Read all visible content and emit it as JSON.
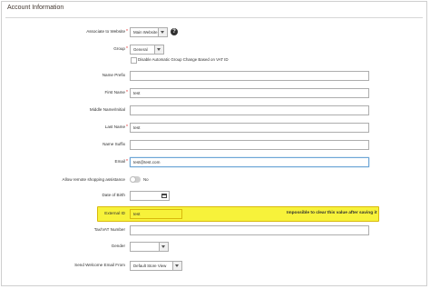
{
  "section": {
    "title": "Account Information"
  },
  "fields": {
    "website": {
      "label": "Associate to Website",
      "value": "Main Website"
    },
    "group": {
      "label": "Group",
      "value": "General"
    },
    "disable_group_change": {
      "label": "Disable Automatic Group Change Based on VAT ID"
    },
    "name_prefix": {
      "label": "Name Prefix",
      "value": ""
    },
    "first_name": {
      "label": "First Name",
      "value": "test"
    },
    "middle_name": {
      "label": "Middle Name/Initial",
      "value": ""
    },
    "last_name": {
      "label": "Last Name",
      "value": "test"
    },
    "name_suffix": {
      "label": "Name Suffix",
      "value": ""
    },
    "email": {
      "label": "Email",
      "value": "test@test.com"
    },
    "remote_assistance": {
      "label": "Allow remote shopping assistance",
      "state": "No"
    },
    "dob": {
      "label": "Date of Birth",
      "value": ""
    },
    "external_id": {
      "label": "External ID",
      "value": "test"
    },
    "tax_vat": {
      "label": "Tax/VAT Number",
      "value": ""
    },
    "gender": {
      "label": "Gender",
      "value": ""
    },
    "welcome_email": {
      "label": "Send Welcome Email From",
      "value": "Default Store View"
    }
  },
  "annotation": {
    "text": "Impossible to clear this value after saving it",
    "color": "#f7f23a"
  },
  "required_marker": "*",
  "help_symbol": "?",
  "colors": {
    "required": "#e22626",
    "focus_border": "#6ea6d6"
  },
  "icons": [
    "help-icon",
    "calendar-icon",
    "chevron-down-icon"
  ]
}
